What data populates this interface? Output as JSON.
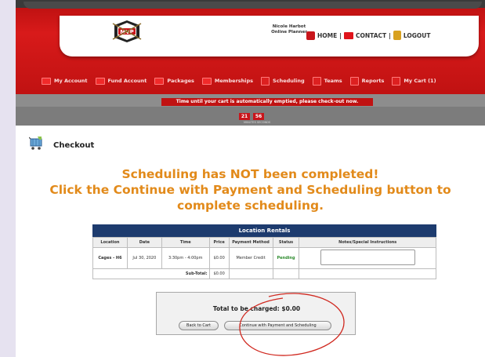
{
  "header": {
    "user_name": "Nicole Harbot",
    "user_role": "Online Planner",
    "links": {
      "home": "HOME",
      "contact": "CONTACT",
      "logout": "LOGOUT",
      "separator": "|"
    }
  },
  "nav": {
    "items": [
      {
        "label": "My Account",
        "icon": "account-icon"
      },
      {
        "label": "Fund Account",
        "icon": "fund-icon"
      },
      {
        "label": "Packages",
        "icon": "packages-icon"
      },
      {
        "label": "Memberships",
        "icon": "memberships-icon"
      },
      {
        "label": "Scheduling",
        "icon": "scheduling-icon"
      },
      {
        "label": "Teams",
        "icon": "teams-icon"
      },
      {
        "label": "Reports",
        "icon": "reports-icon"
      },
      {
        "label": "My Cart (1)",
        "icon": "cart-icon"
      }
    ]
  },
  "timer": {
    "message": "Time until your cart is automatically emptied, please check-out now.",
    "minutes": "21",
    "seconds": "56",
    "caption": "MINUTES   SECONDS"
  },
  "checkout": {
    "title": "Checkout",
    "alert_line1": "Scheduling has NOT been completed!",
    "alert_line2": "Click the Continue with Payment and Scheduling button to",
    "alert_line3": "complete scheduling."
  },
  "table": {
    "title": "Location Rentals",
    "headers": [
      "Location",
      "Date",
      "Time",
      "Price",
      "Payment Method",
      "Status",
      "Notes/Special Instructions"
    ],
    "row": {
      "location": "Cages - H6",
      "date": "Jul 30, 2020",
      "time": "3:30pm - 4:00pm",
      "price": "$0.00",
      "payment_method": "Member Credit",
      "status": "Pending"
    },
    "subtotal_label": "Sub-Total:",
    "subtotal_value": "$0.00"
  },
  "total": {
    "text": "Total to be charged: $0.00",
    "back_button": "Back to Cart",
    "continue_button": "Continue with Payment and Scheduling"
  },
  "colors": {
    "brand_red": "#c8151b",
    "alert_orange": "#e28a1a",
    "table_header": "#1d3b6e",
    "pending_green": "#2e8b2e"
  }
}
